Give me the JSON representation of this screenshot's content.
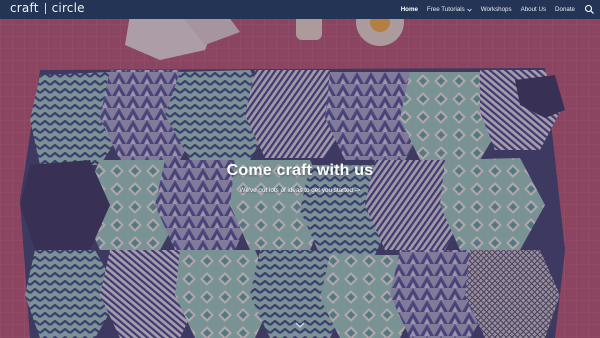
{
  "site": {
    "logo_left": "craft",
    "logo_right": "circle"
  },
  "nav": {
    "items": [
      {
        "label": "Home",
        "active": true,
        "dropdown": false
      },
      {
        "label": "Free Tutorials",
        "active": false,
        "dropdown": true
      },
      {
        "label": "Workshops",
        "active": false,
        "dropdown": false
      },
      {
        "label": "About Us",
        "active": false,
        "dropdown": false
      },
      {
        "label": "Donate",
        "active": false,
        "dropdown": false
      }
    ],
    "search_icon": "search-icon",
    "caret_icon": "chevron-down-icon"
  },
  "hero": {
    "headline": "Come craft with us",
    "subline": "We've got lots of ideas to get you started  ->",
    "scroll_icon": "chevron-down-icon"
  },
  "colors": {
    "navbar": "#233455",
    "overlay": "#5a3a4a",
    "text": "#ffffff"
  }
}
